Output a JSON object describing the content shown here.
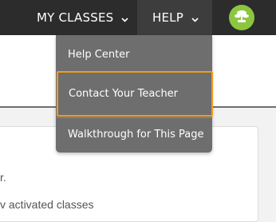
{
  "nav": {
    "my_classes_label": "MY CLASSES",
    "help_label": "HELP",
    "avatar_icon": "bonsai-tree-icon",
    "avatar_color": "#8cc63e"
  },
  "help_menu": {
    "items": [
      {
        "label": "Help Center"
      },
      {
        "label": "Contact Your Teacher",
        "highlighted": true
      },
      {
        "label": "Walkthrough for This Page"
      }
    ],
    "highlight_color": "#f39a1e"
  },
  "content": {
    "line1": "r.",
    "line2": "v activated classes"
  }
}
